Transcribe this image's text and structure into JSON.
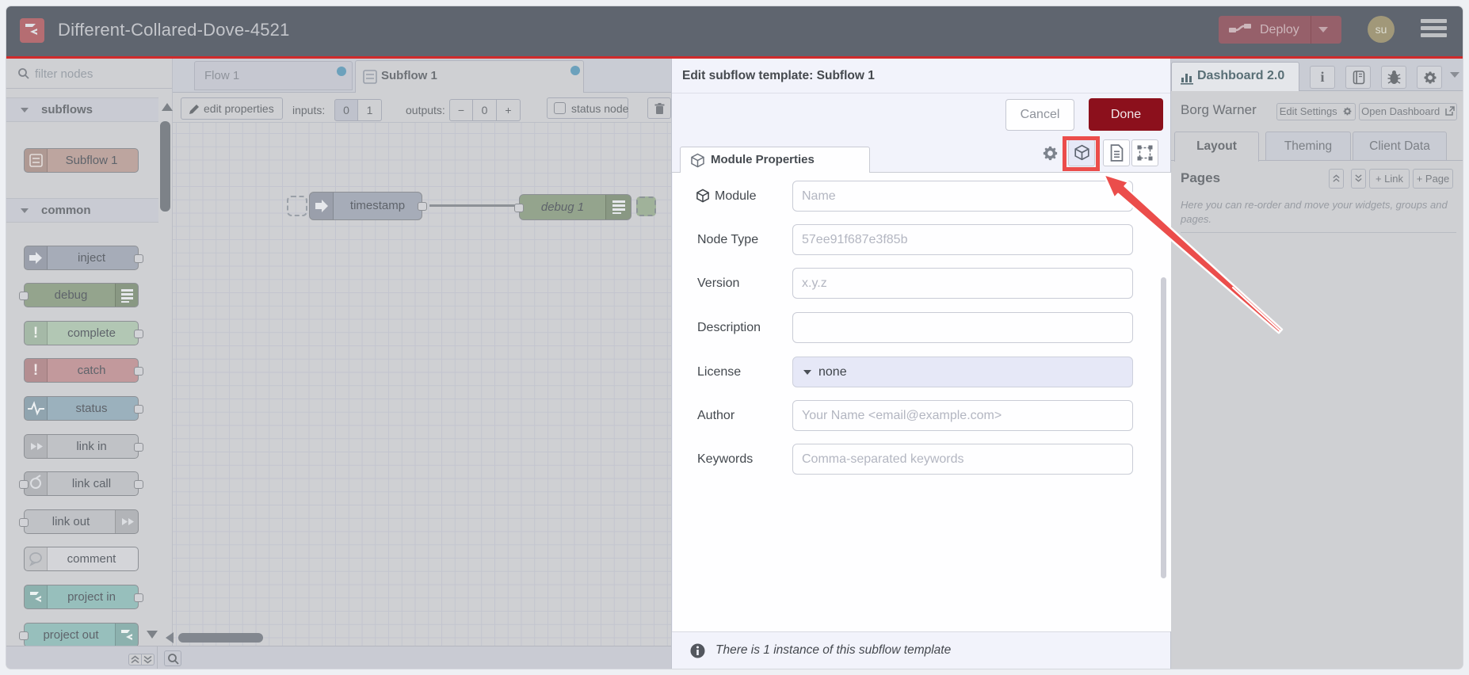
{
  "header": {
    "title": "Different-Collared-Dove-4521",
    "deploy_label": "Deploy",
    "avatar_label": "su"
  },
  "palette": {
    "filter_placeholder": "filter nodes",
    "sections": [
      {
        "label": "subflows",
        "nodes": [
          {
            "label": "Subflow 1",
            "color": "#bda59f"
          }
        ]
      },
      {
        "label": "common",
        "nodes": [
          {
            "label": "inject",
            "color": "#a6acb8"
          },
          {
            "label": "debug",
            "color": "#94a48d"
          },
          {
            "label": "complete",
            "color": "#b2c7b4"
          },
          {
            "label": "catch",
            "color": "#c2999c"
          },
          {
            "label": "status",
            "color": "#9bb1bd"
          },
          {
            "label": "link in",
            "color": "#c0c2c6"
          },
          {
            "label": "link call",
            "color": "#c0c2c6"
          },
          {
            "label": "link out",
            "color": "#c0c2c6"
          },
          {
            "label": "comment",
            "color": "#d4d5d9"
          },
          {
            "label": "project in",
            "color": "#97bfbc"
          },
          {
            "label": "project out",
            "color": "#97bfbc"
          }
        ]
      }
    ]
  },
  "workspace": {
    "tabs": [
      {
        "label": "Flow 1"
      },
      {
        "label": "Subflow 1"
      }
    ],
    "toolbar": {
      "edit_properties": "edit properties",
      "inputs_label": "inputs:",
      "input_zero": "0",
      "input_one": "1",
      "outputs_label": "outputs:",
      "outputs_minus": "−",
      "outputs_value": "0",
      "outputs_plus": "+",
      "status_node_label": "status node"
    },
    "flow_nodes": [
      {
        "label": "timestamp"
      },
      {
        "label": "debug 1"
      }
    ]
  },
  "dialog": {
    "title": "Edit subflow template: Subflow 1",
    "cancel_label": "Cancel",
    "done_label": "Done",
    "tab_label": "Module Properties",
    "fields": [
      {
        "label": "Module",
        "placeholder": "Name"
      },
      {
        "label": "Node Type",
        "placeholder": "57ee91f687e3f85b"
      },
      {
        "label": "Version",
        "placeholder": "x.y.z"
      },
      {
        "label": "Description",
        "placeholder": ""
      },
      {
        "label": "License",
        "value": "none"
      },
      {
        "label": "Author",
        "placeholder": "Your Name <email@example.com>"
      },
      {
        "label": "Keywords",
        "placeholder": "Comma-separated keywords"
      }
    ],
    "footer_text": "There is 1 instance of this subflow template"
  },
  "sidebar": {
    "tab_label": "Dashboard 2.0",
    "project_name": "Borg Warner",
    "edit_settings_label": "Edit Settings",
    "open_dashboard_label": "Open Dashboard",
    "tabs": [
      "Layout",
      "Theming",
      "Client Data"
    ],
    "pages_title": "Pages",
    "link_button": "+ Link",
    "page_button": "+ Page",
    "help_text": "Here you can re-order and move your widgets, groups and pages."
  },
  "colors": {
    "header_bg": "#5f656f",
    "accent_red_line": "#d12b2b",
    "done_button": "#8c101c",
    "annotation_red": "#eb4d4b",
    "unsaved_dot": "#6ca1bc",
    "license_bg": "#e6e8f7"
  }
}
